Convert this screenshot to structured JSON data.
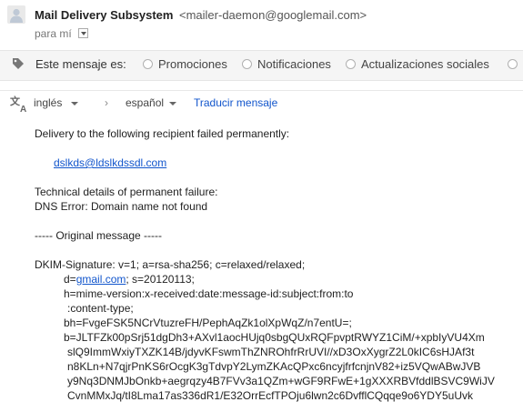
{
  "header": {
    "sender_name": "Mail Delivery Subsystem",
    "sender_email": "<mailer-daemon@googlemail.com>",
    "to_line": "para mí"
  },
  "categories": {
    "label": "Este mensaje es:",
    "options": [
      "Promociones",
      "Notificaciones",
      "Actualizaciones sociales"
    ]
  },
  "translate": {
    "from_lang": "inglés",
    "to_lang": "español",
    "action": "Traducir mensaje"
  },
  "message": {
    "intro": "Delivery to the following recipient failed permanently:",
    "recipient": "dslkds@ldslkdssdl.com",
    "details_heading": "Technical details of permanent failure:",
    "dns_error": "DNS Error: Domain name not found",
    "original_heading": "----- Original message -----",
    "dkim_line1": "DKIM-Signature: v=1; a=rsa-sha256; c=relaxed/relaxed;",
    "dkim_d_prefix": "d=",
    "dkim_d_link": "gmail.com",
    "dkim_d_suffix": "; s=20120113;",
    "dkim_h1": "h=mime-version:x-received:date:message-id:subject:from:to",
    "dkim_h2": ":content-type;",
    "dkim_bh": "bh=FvgeFSK5NCrVtuzreFH/PephAqZk1olXpWqZ/n7entU=;",
    "dkim_b1": "b=JLTFZk00pSrj51dgDh3+AXvl1aocHUjq0sbgQUxRQFpvptRWYZ1CiM/+xpbIyVU4Xm",
    "dkim_b2": "slQ9ImmWxiyTXZK14B/jdyvKFswmThZNROhfrRrUVI//xD3OxXygrZ2L0kIC6sHJAf3t",
    "dkim_b3": "n8KLn+N7qjrPnKS6rOcgK3gTdvpY2LymZKAcQPxc6ncyjfrfcnjnV82+iz5VQwABwJVB",
    "dkim_b4": "y9Nq3DNMJbOnkb+aegrqzy4B7FVv3a1QZm+wGF9RFwE+1gXXXRBVfddlBSVC9WiJV",
    "dkim_b5": "CvnMMxJq/tI8Lma17as336dR1/E32OrrEcfTPOju6lwn2c6DvfflCQqqe9o6YDY5uUvk"
  },
  "colors": {
    "link": "#1155cc",
    "category_bar": "#f5f5f5"
  },
  "icons": {
    "avatar": "person-avatar-icon",
    "tag": "tag-icon",
    "translate": "translate-icon"
  }
}
